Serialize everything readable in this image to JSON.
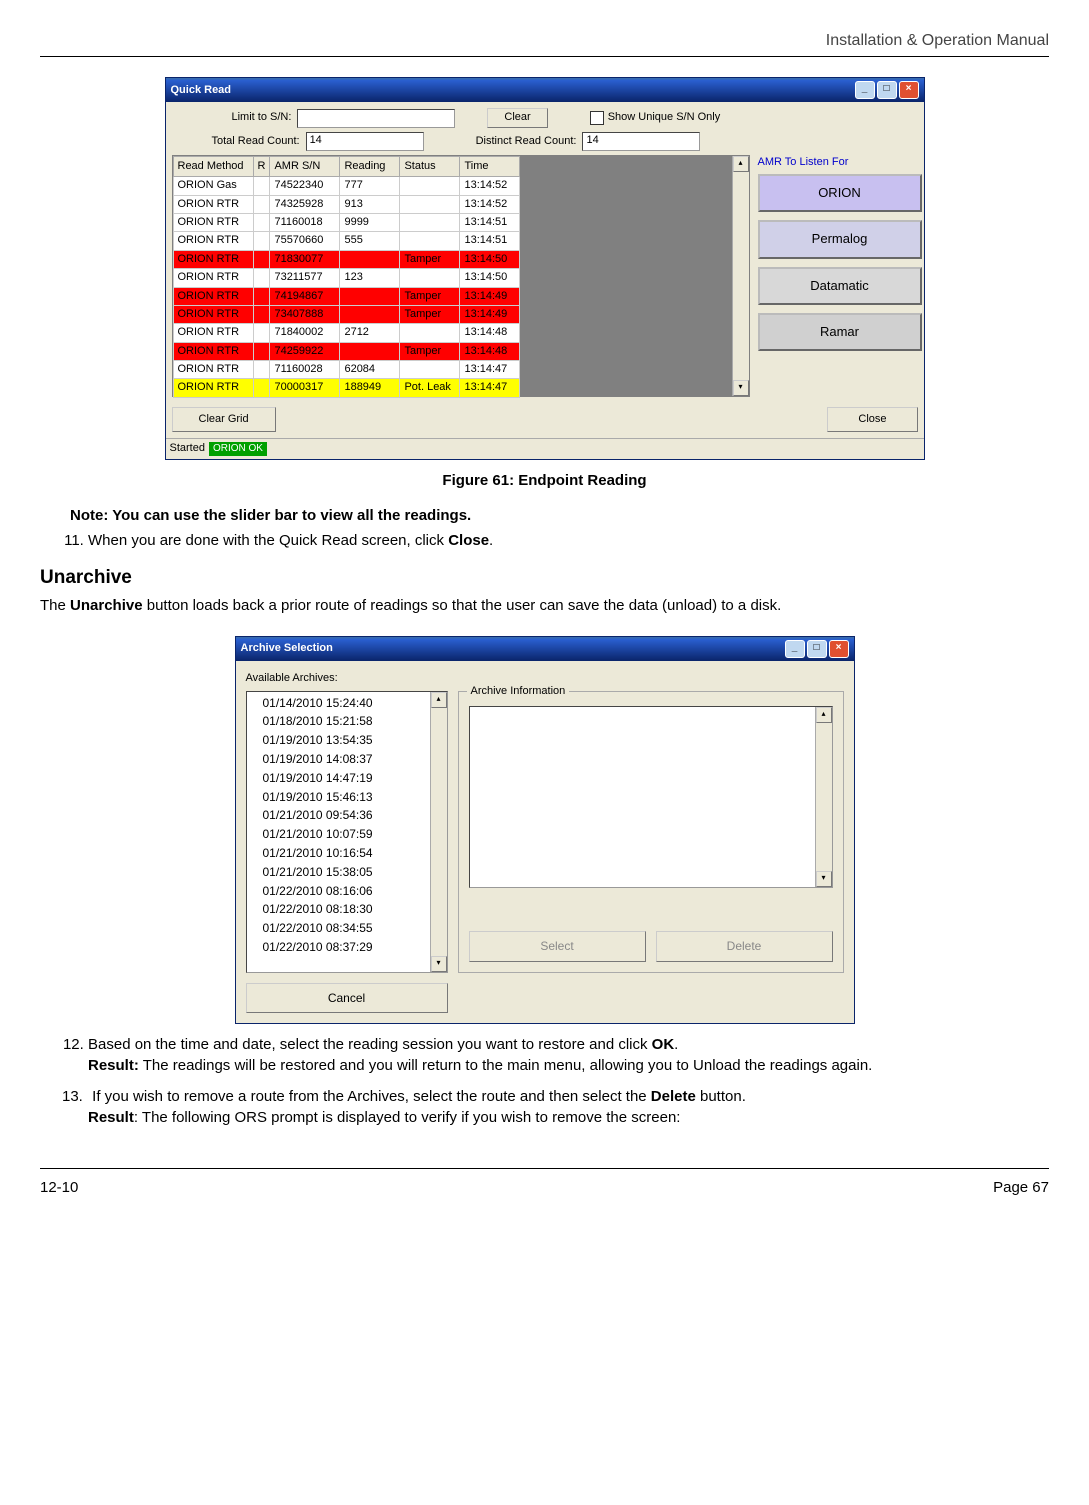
{
  "header": {
    "title": "Installation & Operation Manual"
  },
  "quickread": {
    "window_title": "Quick Read",
    "labels": {
      "limit": "Limit to S/N:",
      "clear": "Clear",
      "show_unique": "Show Unique S/N Only",
      "total_read": "Total Read Count:",
      "total_read_val": "14",
      "distinct_read": "Distinct Read Count:",
      "distinct_read_val": "14",
      "clear_grid": "Clear Grid",
      "close": "Close",
      "status_started": "Started",
      "status_ok": "ORION OK"
    },
    "columns": [
      "Read Method",
      "R",
      "AMR S/N",
      "Reading",
      "Status",
      "Time"
    ],
    "rows": [
      {
        "c": [
          "ORION Gas",
          "",
          "74522340",
          "777",
          "",
          "13:14:52"
        ],
        "cls": ""
      },
      {
        "c": [
          "ORION RTR",
          "",
          "74325928",
          "913",
          "",
          "13:14:52"
        ],
        "cls": ""
      },
      {
        "c": [
          "ORION RTR",
          "",
          "71160018",
          "9999",
          "",
          "13:14:51"
        ],
        "cls": ""
      },
      {
        "c": [
          "ORION RTR",
          "",
          "75570660",
          "555",
          "",
          "13:14:51"
        ],
        "cls": ""
      },
      {
        "c": [
          "ORION RTR",
          "",
          "71830077",
          "",
          "Tamper",
          "13:14:50"
        ],
        "cls": "red"
      },
      {
        "c": [
          "ORION RTR",
          "",
          "73211577",
          "123",
          "",
          "13:14:50"
        ],
        "cls": ""
      },
      {
        "c": [
          "ORION RTR",
          "",
          "74194867",
          "",
          "Tamper",
          "13:14:49"
        ],
        "cls": "red"
      },
      {
        "c": [
          "ORION RTR",
          "",
          "73407888",
          "",
          "Tamper",
          "13:14:49"
        ],
        "cls": "red"
      },
      {
        "c": [
          "ORION RTR",
          "",
          "71840002",
          "2712",
          "",
          "13:14:48"
        ],
        "cls": ""
      },
      {
        "c": [
          "ORION RTR",
          "",
          "74259922",
          "",
          "Tamper",
          "13:14:48"
        ],
        "cls": "red"
      },
      {
        "c": [
          "ORION RTR",
          "",
          "71160028",
          "62084",
          "",
          "13:14:47"
        ],
        "cls": ""
      },
      {
        "c": [
          "ORION RTR",
          "",
          "70000317",
          "188949",
          "Pot. Leak",
          "13:14:47"
        ],
        "cls": "yellow"
      }
    ],
    "side": {
      "title": "AMR To Listen For",
      "buttons": [
        "ORION",
        "Permalog",
        "Datamatic",
        "Ramar"
      ]
    }
  },
  "figure_caption": "Figure 61:  Endpoint Reading",
  "note": "Note: You can use the slider bar to view all the readings.",
  "step11_prefix": "When you are done with the Quick Read screen, click ",
  "step11_bold": "Close",
  "step11_suffix": ".",
  "section_heading": "Unarchive",
  "section_body_prefix": "The ",
  "section_body_bold": "Unarchive",
  "section_body_suffix": " button loads back a prior route of readings so that the user can save the data (unload) to a disk.",
  "archive": {
    "window_title": "Archive Selection",
    "available_label": "Available Archives:",
    "info_label": "Archive Information",
    "items": [
      "01/14/2010 15:24:40",
      "01/18/2010 15:21:58",
      "01/19/2010 13:54:35",
      "01/19/2010 14:08:37",
      "01/19/2010 14:47:19",
      "01/19/2010 15:46:13",
      "01/21/2010 09:54:36",
      "01/21/2010 10:07:59",
      "01/21/2010 10:16:54",
      "01/21/2010 15:38:05",
      "01/22/2010 08:16:06",
      "01/22/2010 08:18:30",
      "01/22/2010 08:34:55",
      "01/22/2010 08:37:29"
    ],
    "buttons": {
      "cancel": "Cancel",
      "select": "Select",
      "delete": "Delete"
    }
  },
  "step12": {
    "line1a": "Based on the time and date, select the reading session you want to restore and click ",
    "line1b": "OK",
    "line1c": ".",
    "result_label": "Result:",
    "result_text": "  The readings will be restored and you will return to the main menu, allowing you to Unload the readings again."
  },
  "step13": {
    "num": "13.",
    "line1a": " If you wish to remove a route from the Archives, select the route and then select the ",
    "line1b": "Delete",
    "line1c": " button.",
    "result_label": "Result",
    "result_text": ": The following ORS prompt is displayed to verify if you wish to remove the screen:"
  },
  "footer": {
    "left": "12-10",
    "right": "Page 67"
  }
}
